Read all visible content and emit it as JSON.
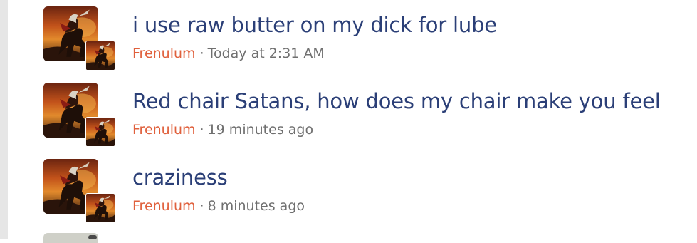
{
  "threads": [
    {
      "title": "i use raw butter on my dick for lube",
      "author": "Frenulum",
      "separator": "·",
      "time": "Today at 2:31 AM"
    },
    {
      "title": "Red chair Satans, how does my chair make you feel",
      "author": "Frenulum",
      "separator": "·",
      "time": "19 minutes ago"
    },
    {
      "title": "craziness",
      "author": "Frenulum",
      "separator": "·",
      "time": "8 minutes ago"
    }
  ],
  "colors": {
    "title": "#2b3f77",
    "author": "#e0603c",
    "meta": "#6f6f6f",
    "rail": "#e6e6e6"
  }
}
